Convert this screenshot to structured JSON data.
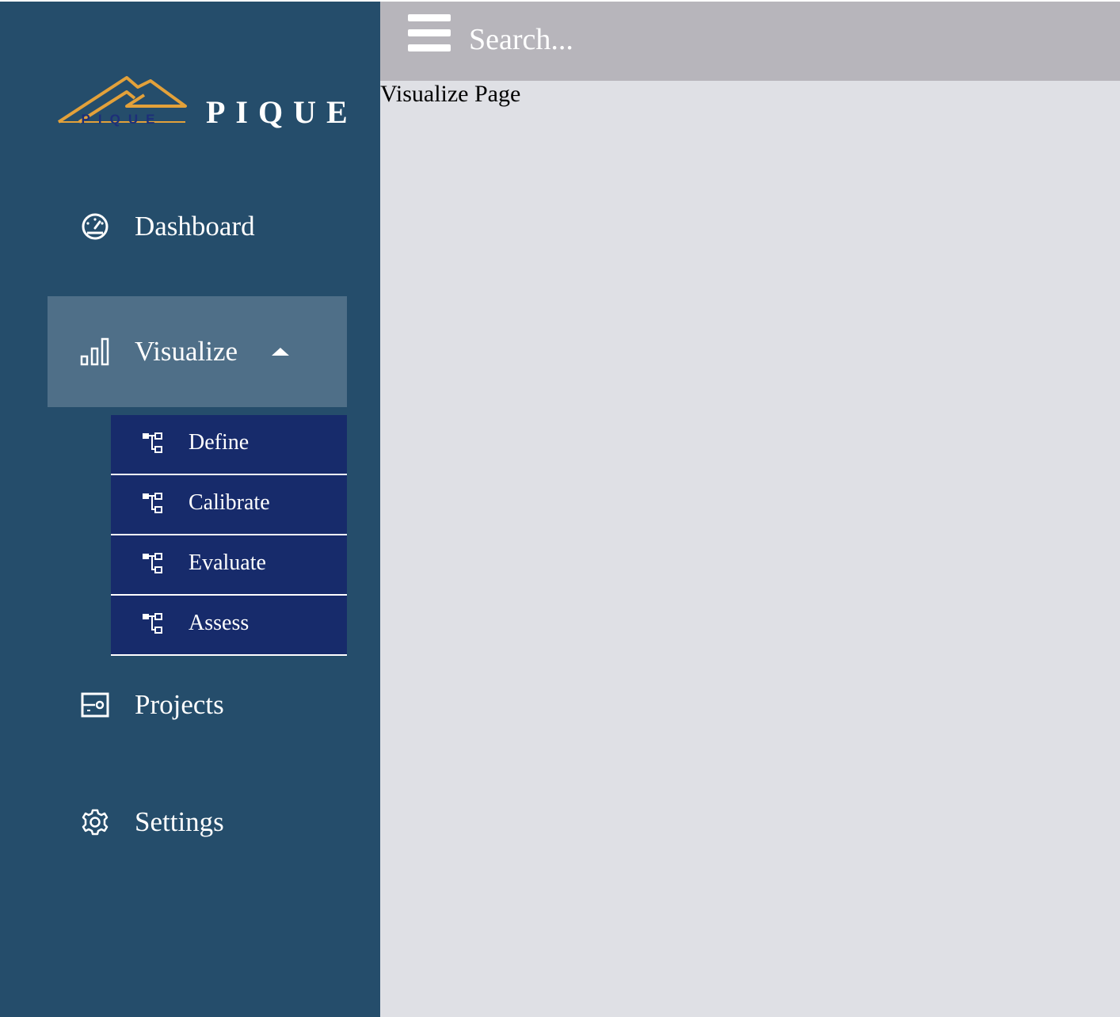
{
  "brand": {
    "name": "PIQUE",
    "logo_mark_text": "PIQUE"
  },
  "colors": {
    "sidebar": "#254d6b",
    "active_item": "#4f6f88",
    "submenu": "#172b6b",
    "topbar": "#b7b5bb",
    "main": "#dfe0e5",
    "logo_orange": "#e3a13a"
  },
  "sidebar": {
    "items": [
      {
        "label": "Dashboard",
        "icon": "speedometer-icon"
      },
      {
        "label": "Visualize",
        "icon": "bar-chart-icon",
        "expanded": true
      },
      {
        "label": "Projects",
        "icon": "projects-icon"
      },
      {
        "label": "Settings",
        "icon": "gear-icon"
      }
    ],
    "submenu": [
      {
        "label": "Define",
        "icon": "tree-icon"
      },
      {
        "label": "Calibrate",
        "icon": "tree-icon"
      },
      {
        "label": "Evaluate",
        "icon": "tree-icon"
      },
      {
        "label": "Assess",
        "icon": "tree-icon"
      }
    ]
  },
  "topbar": {
    "menu_icon": "hamburger-icon",
    "search_placeholder": "Search..."
  },
  "main": {
    "title": "Visualize Page"
  }
}
